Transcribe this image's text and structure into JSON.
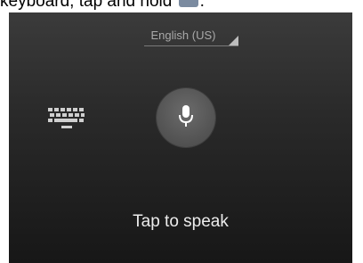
{
  "instruction": {
    "text_before": "keyboard, tap and hold",
    "text_after": ".",
    "inline_icon": "keyboard-key-icon"
  },
  "voice_input": {
    "language": "English (US)",
    "prompt": "Tap to speak",
    "mic_icon": "microphone-icon",
    "keyboard_icon": "keyboard-icon"
  },
  "colors": {
    "background_top": "#3b3b3b",
    "background_bottom": "#171717",
    "mic_button": "#5a5a5a",
    "text_light": "#ededed",
    "text_dim": "#a9a9a9",
    "icon_key": "#7b8ba0"
  }
}
